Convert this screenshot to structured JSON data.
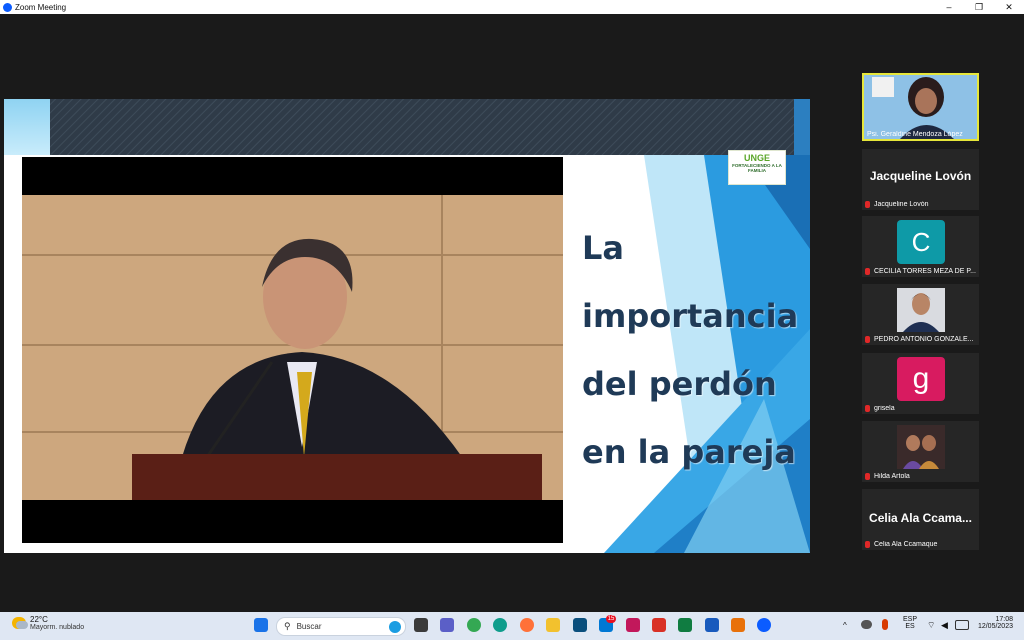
{
  "window": {
    "title": "Zoom Meeting",
    "controls": [
      "–",
      "❐",
      "✕"
    ]
  },
  "slide": {
    "title": "La\nimportancia\ndel perdón\nen la pareja",
    "logo_text": "UNGE",
    "logo_sub": "FORTALECIENDO A LA FAMILIA"
  },
  "participants": [
    {
      "name": "Psi. Geraldine Mendoza López",
      "type": "video-active"
    },
    {
      "name": "Jacqueline Lovón",
      "display": "Jacqueline Lovón",
      "type": "name"
    },
    {
      "name": "CECILIA TORRES MEZA DE P...",
      "avatar_letter": "C",
      "avatar_color": "#0e9aa7",
      "type": "avatar"
    },
    {
      "name": "PEDRO ANTONIO GONZALE...",
      "type": "photo"
    },
    {
      "name": "grisela",
      "avatar_letter": "g",
      "avatar_color": "#d81b60",
      "type": "avatar"
    },
    {
      "name": "Hilda Artola",
      "type": "photo"
    },
    {
      "name": "Celia Ala Ccamaque",
      "display": "Celia Ala Ccama...",
      "type": "name"
    }
  ],
  "taskbar": {
    "weather_temp": "22°C",
    "weather_desc": "Mayorm. nublado",
    "search_placeholder": "Buscar",
    "lang_top": "ESP",
    "lang_bottom": "ES",
    "time": "17:08",
    "date": "12/05/2023",
    "mail_badge": "15"
  },
  "colors": {
    "accent": "#0b5cff",
    "active_speaker_border": "#e6e63a",
    "muted_mic": "#e02828"
  }
}
